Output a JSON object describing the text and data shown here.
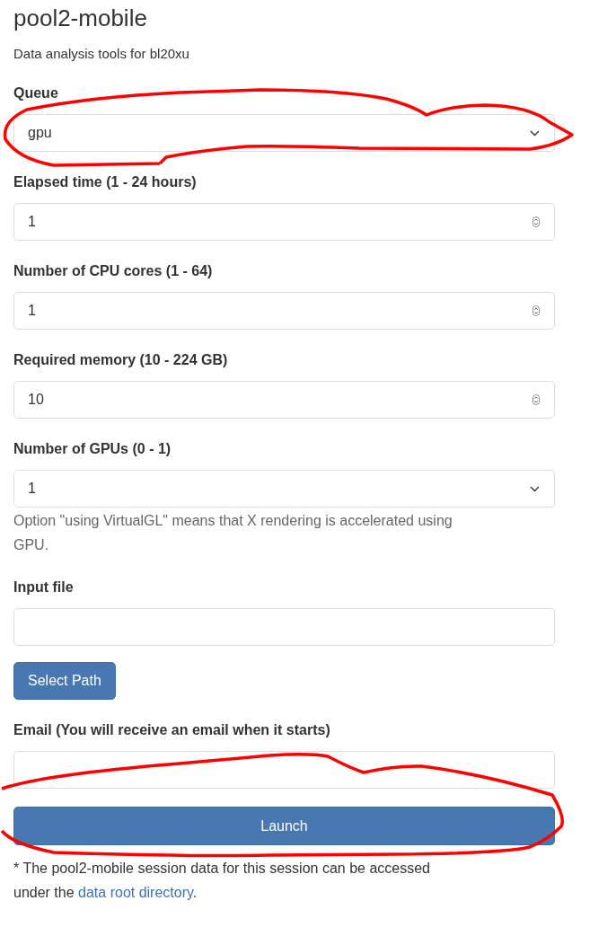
{
  "title": "pool2-mobile",
  "subtitle": "Data analysis tools for bl20xu",
  "fields": [
    {
      "kind": "select",
      "label": "Queue",
      "value": "gpu"
    },
    {
      "kind": "number",
      "label": "Elapsed time (1 - 24 hours)",
      "value": "1"
    },
    {
      "kind": "number",
      "label": "Number of CPU cores (1 - 64)",
      "value": "1"
    },
    {
      "kind": "number",
      "label": "Required memory (10 - 224 GB)",
      "value": "10"
    },
    {
      "kind": "select",
      "label": "Number of GPUs (0 - 1)",
      "value": "1",
      "help": "Option \"using VirtualGL\" means that X rendering is accelerated using GPU."
    },
    {
      "kind": "text",
      "label": "Input file",
      "button": "Select Path"
    },
    {
      "kind": "text",
      "label": "Email (You will receive an email when it starts)"
    }
  ],
  "launch_button": "Launch",
  "footer": {
    "before": "* The pool2-mobile session data for this session can be accessed under the",
    "link": "data root directory",
    "after": "."
  }
}
